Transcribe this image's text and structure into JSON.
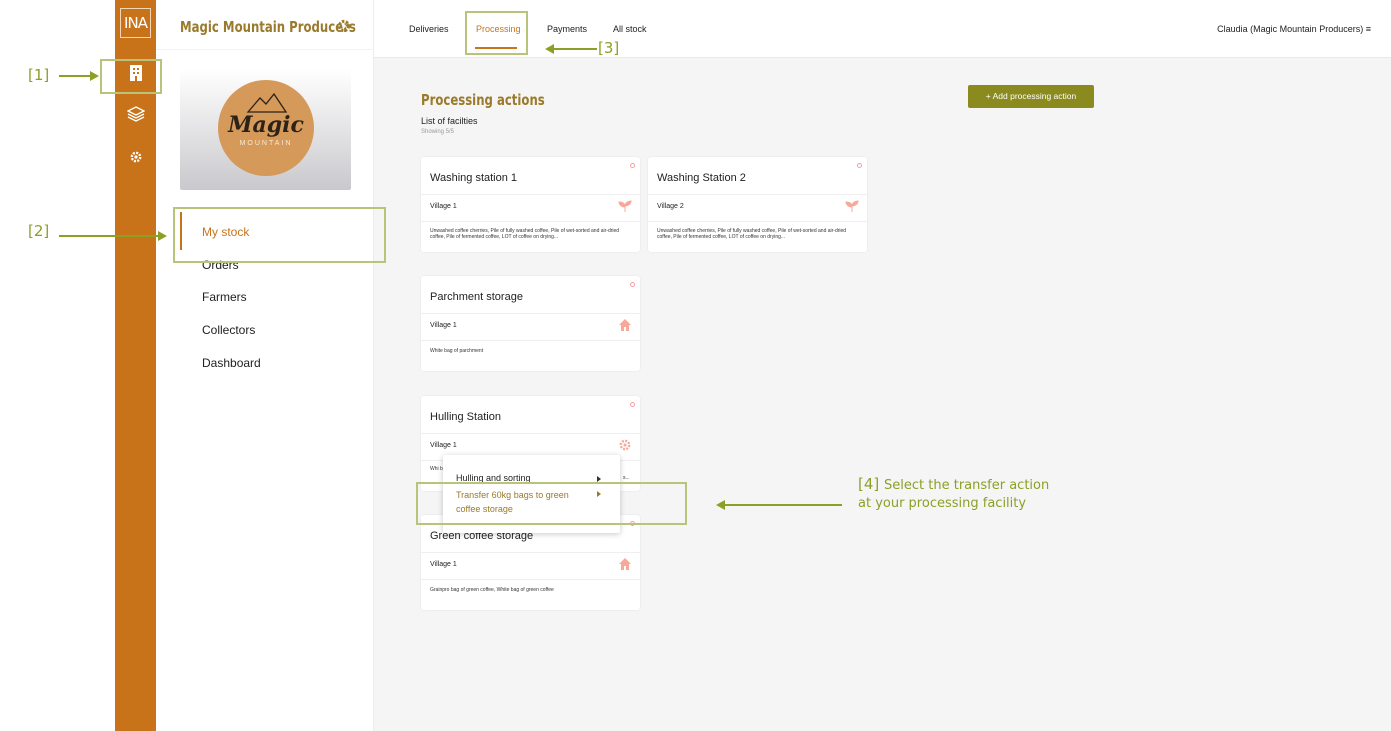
{
  "rail": {
    "logo": "INA",
    "items": [
      "facility-icon",
      "layers-icon",
      "gear-icon"
    ]
  },
  "sidebar": {
    "org_name": "Magic Mountain Producers",
    "logo": {
      "word": "Magic",
      "sub": "MOUNTAIN"
    },
    "nav": [
      "My stock",
      "Orders",
      "Farmers",
      "Collectors",
      "Dashboard"
    ],
    "active_nav": "My stock"
  },
  "topbar": {
    "tabs": [
      "Deliveries",
      "Processing",
      "Payments",
      "All stock"
    ],
    "active_tab": "Processing",
    "user": "Claudia (Magic Mountain Producers)"
  },
  "main": {
    "heading": "Processing actions",
    "subheading": "List of facilties",
    "showing": "Showing 5/5",
    "add_button": "+ Add processing action",
    "cards": [
      {
        "title": "Washing station 1",
        "location": "Village 1",
        "icon": "sprout-icon",
        "desc": "Unwashed coffee cherries, Pile of fully washed coffee, Pile of wet-sorted and air-dried coffee, Pile of fermented coffee, LOT of coffee on drying..."
      },
      {
        "title": "Washing Station 2",
        "location": "Village 2",
        "icon": "sprout-icon",
        "desc": "Unwashed coffee cherries, Pile of fully washed coffee, Pile of wet-sorted and air-dried coffee, Pile of fermented coffee, LOT of coffee on drying..."
      },
      {
        "title": "Parchment storage",
        "location": "Village 1",
        "icon": "house-icon",
        "desc": "White bag of parchment"
      },
      {
        "title": "Hulling Station",
        "location": "Village 1",
        "icon": "gear-icon",
        "desc_partial_left": "Whi bag",
        "desc_partial_right": "s..."
      },
      {
        "title": "Green coffee storage",
        "location": "Village 1",
        "icon": "house-icon",
        "desc": "Grainpro bag of green coffee, White bag of green coffee"
      }
    ]
  },
  "context_menu": {
    "items": [
      "Hulling and sorting",
      "Transfer 60kg bags to green coffee storage"
    ]
  },
  "annotations": {
    "a1": "[1]",
    "a2": "[2]",
    "a3": "[3]",
    "a4_num": "[4]",
    "a4_line1": "Select the transfer action",
    "a4_line2": "at your processing facility",
    "color": "#8aa126"
  },
  "colors": {
    "brand": "#c8731a",
    "accent": "#9a7a2c",
    "button": "#8b8a1f"
  }
}
